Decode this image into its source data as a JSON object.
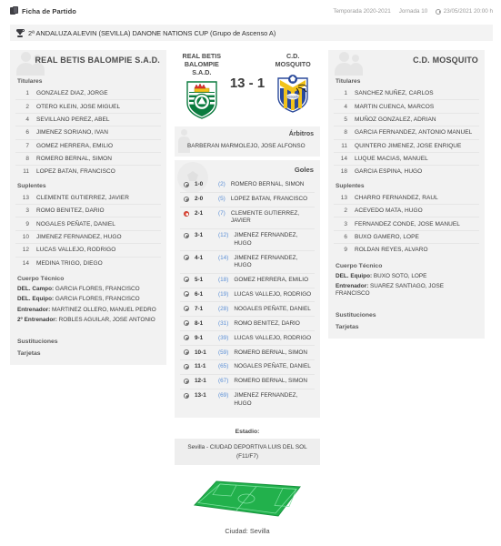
{
  "header": {
    "breadcrumb": "Ficha de Partido",
    "season": "Temporada 2020-2021",
    "matchday": "Jornada 10",
    "datetime": "23/05/2021 20:00 h",
    "competition": "2ª ANDALUZA ALEVIN (SEVILLA) DANONE NATIONS CUP (Grupo de Ascenso A)"
  },
  "home": {
    "name": "REAL BETIS BALOMPIE S.A.D.",
    "short_name_lines": "REAL BETIS BALOMPIE S.A.D.",
    "starters_label": "Titulares",
    "subs_label": "Suplentes",
    "starters": [
      {
        "num": "1",
        "name": "GONZALEZ DIAZ, JORGE"
      },
      {
        "num": "2",
        "name": "OTERO KLEIN, JOSE MIGUEL"
      },
      {
        "num": "4",
        "name": "SEVILLANO PEREZ, ABEL"
      },
      {
        "num": "6",
        "name": "JIMENEZ SORIANO, IVAN"
      },
      {
        "num": "7",
        "name": "GOMEZ HERRERA, EMILIO"
      },
      {
        "num": "8",
        "name": "ROMERO BERNAL, SIMON"
      },
      {
        "num": "11",
        "name": "LOPEZ BATAN, FRANCISCO"
      }
    ],
    "subs": [
      {
        "num": "13",
        "name": "CLEMENTE GUTIERREZ, JAVIER"
      },
      {
        "num": "3",
        "name": "ROMO BENITEZ, DARIO"
      },
      {
        "num": "9",
        "name": "NOGALES PEÑATE, DANIEL"
      },
      {
        "num": "10",
        "name": "JIMENEZ FERNANDEZ, HUGO"
      },
      {
        "num": "12",
        "name": "LUCAS VALLEJO, RODRIGO"
      },
      {
        "num": "14",
        "name": "MEDINA TRIGO, DIEGO"
      }
    ],
    "staff_label": "Cuerpo Técnico",
    "staff": [
      {
        "role": "DEL. Campo:",
        "name": "GARCIA FLORES, FRANCISCO"
      },
      {
        "role": "DEL. Equipo:",
        "name": "GARCIA FLORES, FRANCISCO"
      },
      {
        "role": "Entrenador:",
        "name": "MARTINEZ OLLERO, MANUEL PEDRO"
      },
      {
        "role": "2º Entrenador:",
        "name": "ROBLES AGUILAR, JOSE ANTONIO"
      }
    ],
    "subs_section_label": "Sustituciones",
    "cards_section_label": "Tarjetas"
  },
  "away": {
    "name": "C.D. MOSQUITO",
    "starters_label": "Titulares",
    "subs_label": "Suplentes",
    "starters": [
      {
        "num": "1",
        "name": "SANCHEZ NUÑEZ, CARLOS"
      },
      {
        "num": "4",
        "name": "MARTIN CUENCA, MARCOS"
      },
      {
        "num": "5",
        "name": "MUÑOZ GONZALEZ, ADRIAN"
      },
      {
        "num": "8",
        "name": "GARCIA FERNANDEZ, ANTONIO MANUEL"
      },
      {
        "num": "11",
        "name": "QUINTERO JIMENEZ, JOSE ENRIQUE"
      },
      {
        "num": "14",
        "name": "LUQUE MACIAS, MANUEL"
      },
      {
        "num": "18",
        "name": "GARCIA ESPINA, HUGO"
      }
    ],
    "subs": [
      {
        "num": "13",
        "name": "CHARRO FERNANDEZ, RAUL"
      },
      {
        "num": "2",
        "name": "ACEVEDO MATA, HUGO"
      },
      {
        "num": "3",
        "name": "FERNANDEZ CONDE, JOSE MANUEL"
      },
      {
        "num": "6",
        "name": "BUXO GAMERO, LOPE"
      },
      {
        "num": "9",
        "name": "ROLDAN REYES, ALVARO"
      }
    ],
    "staff_label": "Cuerpo Técnico",
    "staff": [
      {
        "role": "DEL. Equipo:",
        "name": "BUXO SOTO, LOPE"
      },
      {
        "role": "Entrenador:",
        "name": "SUAREZ SANTIAGO, JOSE FRANCISCO"
      }
    ],
    "subs_section_label": "Sustituciones",
    "cards_section_label": "Tarjetas"
  },
  "scoreboard": {
    "home_team": "REAL BETIS BALOMPIE S.A.D.",
    "away_team": "C.D. MOSQUITO",
    "score": "13 - 1",
    "home_goals": 13,
    "away_goals": 1
  },
  "referees": {
    "label": "Árbitros",
    "names": "BARBERAN MARMOLEJO, JOSE ALFONSO"
  },
  "goals": {
    "label": "Goles",
    "items": [
      {
        "score": "1-0",
        "minute": "(2)",
        "player": "ROMERO BERNAL, SIMON",
        "own_goal": false
      },
      {
        "score": "2-0",
        "minute": "(5)",
        "player": "LOPEZ BATAN, FRANCISCO",
        "own_goal": false
      },
      {
        "score": "2-1",
        "minute": "(7)",
        "player": "CLEMENTE GUTIERREZ, JAVIER",
        "own_goal": true
      },
      {
        "score": "3-1",
        "minute": "(12)",
        "player": "JIMENEZ FERNANDEZ, HUGO",
        "own_goal": false
      },
      {
        "score": "4-1",
        "minute": "(14)",
        "player": "JIMENEZ FERNANDEZ, HUGO",
        "own_goal": false
      },
      {
        "score": "5-1",
        "minute": "(18)",
        "player": "GOMEZ HERRERA, EMILIO",
        "own_goal": false
      },
      {
        "score": "6-1",
        "minute": "(19)",
        "player": "LUCAS VALLEJO, RODRIGO",
        "own_goal": false
      },
      {
        "score": "7-1",
        "minute": "(28)",
        "player": "NOGALES PEÑATE, DANIEL",
        "own_goal": false
      },
      {
        "score": "8-1",
        "minute": "(31)",
        "player": "ROMO BENITEZ, DARIO",
        "own_goal": false
      },
      {
        "score": "9-1",
        "minute": "(39)",
        "player": "LUCAS VALLEJO, RODRIGO",
        "own_goal": false
      },
      {
        "score": "10-1",
        "minute": "(59)",
        "player": "ROMERO BERNAL, SIMON",
        "own_goal": false
      },
      {
        "score": "11-1",
        "minute": "(65)",
        "player": "NOGALES PEÑATE, DANIEL",
        "own_goal": false
      },
      {
        "score": "12-1",
        "minute": "(67)",
        "player": "ROMERO BERNAL, SIMON",
        "own_goal": false
      },
      {
        "score": "13-1",
        "minute": "(69)",
        "player": "JIMENEZ FERNANDEZ, HUGO",
        "own_goal": false
      }
    ]
  },
  "stadium": {
    "label": "Estadio:",
    "line1": "Sevilla - CIUDAD DEPORTIVA LUIS DEL SOL",
    "line2": "(F11/F7)",
    "city": "Ciudad: Sevilla"
  },
  "colors": {
    "betis_green": "#0a7b3e",
    "mosquito_blue": "#2b4a9b",
    "mosquito_yellow": "#f2c31a",
    "pitch_green": "#22b14c",
    "minute_blue": "#5b8fd6",
    "own_goal_red": "#e74c3c"
  }
}
